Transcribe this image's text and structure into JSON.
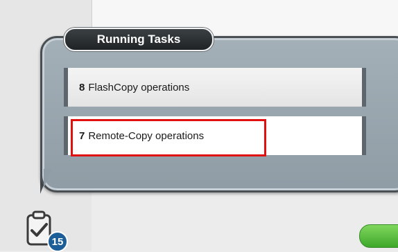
{
  "popover": {
    "title": "Running Tasks",
    "tasks": [
      {
        "count": "8",
        "label": "FlashCopy operations"
      },
      {
        "count": "7",
        "label": "Remote-Copy operations"
      }
    ]
  },
  "footer": {
    "tasks_badge": "15",
    "icon": "clipboard-check-icon"
  },
  "colors": {
    "highlight": "#e01010",
    "badge": "#1c5f98",
    "status_green": "#3ea82b"
  }
}
